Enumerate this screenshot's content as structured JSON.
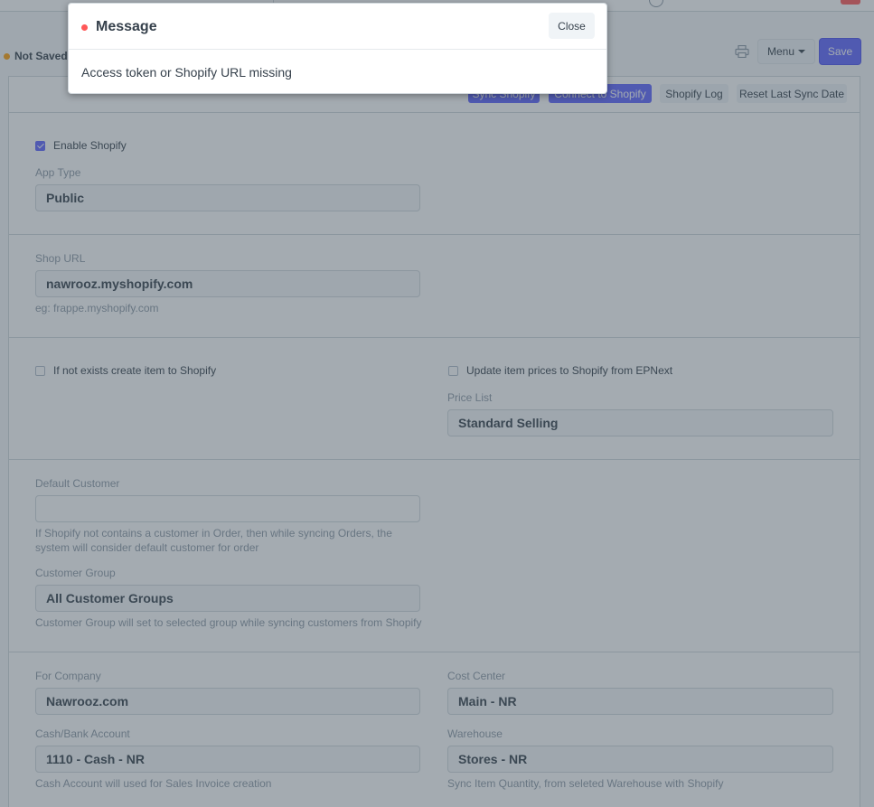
{
  "header": {
    "status": "Not Saved",
    "menu_label": "Menu",
    "save_label": "Save"
  },
  "toolbar": {
    "sync_shopify": "Sync Shopify",
    "connect_to_shopify": "Connect to Shopify",
    "shopify_log": "Shopify Log",
    "reset_last_sync_date": "Reset Last Sync Date"
  },
  "form": {
    "enable_shopify": {
      "label": "Enable Shopify",
      "checked": true
    },
    "app_type": {
      "label": "App Type",
      "value": "Public"
    },
    "shop_url": {
      "label": "Shop URL",
      "value": "nawrooz.myshopify.com",
      "help": "eg: frappe.myshopify.com"
    },
    "create_item": {
      "label": "If not exists create item to Shopify",
      "checked": false
    },
    "update_prices": {
      "label": "Update item prices to Shopify from EPNext",
      "checked": false
    },
    "price_list": {
      "label": "Price List",
      "value": "Standard Selling"
    },
    "default_customer": {
      "label": "Default Customer",
      "value": "",
      "help_line1": "If Shopify not contains a customer in Order, then while syncing Orders, the",
      "help_line2": "system will consider default customer for order"
    },
    "customer_group": {
      "label": "Customer Group",
      "value": "All Customer Groups",
      "help": "Customer Group will set to selected group while syncing customers from Shopify"
    },
    "for_company": {
      "label": "For Company",
      "value": "Nawrooz.com"
    },
    "cost_center": {
      "label": "Cost Center",
      "value": "Main - NR"
    },
    "cash_bank_account": {
      "label": "Cash/Bank Account",
      "value": "1110 - Cash - NR",
      "help": "Cash Account will used for Sales Invoice creation"
    },
    "warehouse": {
      "label": "Warehouse",
      "value": "Stores - NR",
      "help": "Sync Item Quantity, from seleted Warehouse with Shopify"
    }
  },
  "modal": {
    "title": "Message",
    "close_label": "Close",
    "body": "Access token or Shopify URL missing"
  },
  "colors": {
    "primary": "#5e64ff",
    "indicator_orange": "#ffa00a",
    "indicator_red": "#ff5858"
  }
}
